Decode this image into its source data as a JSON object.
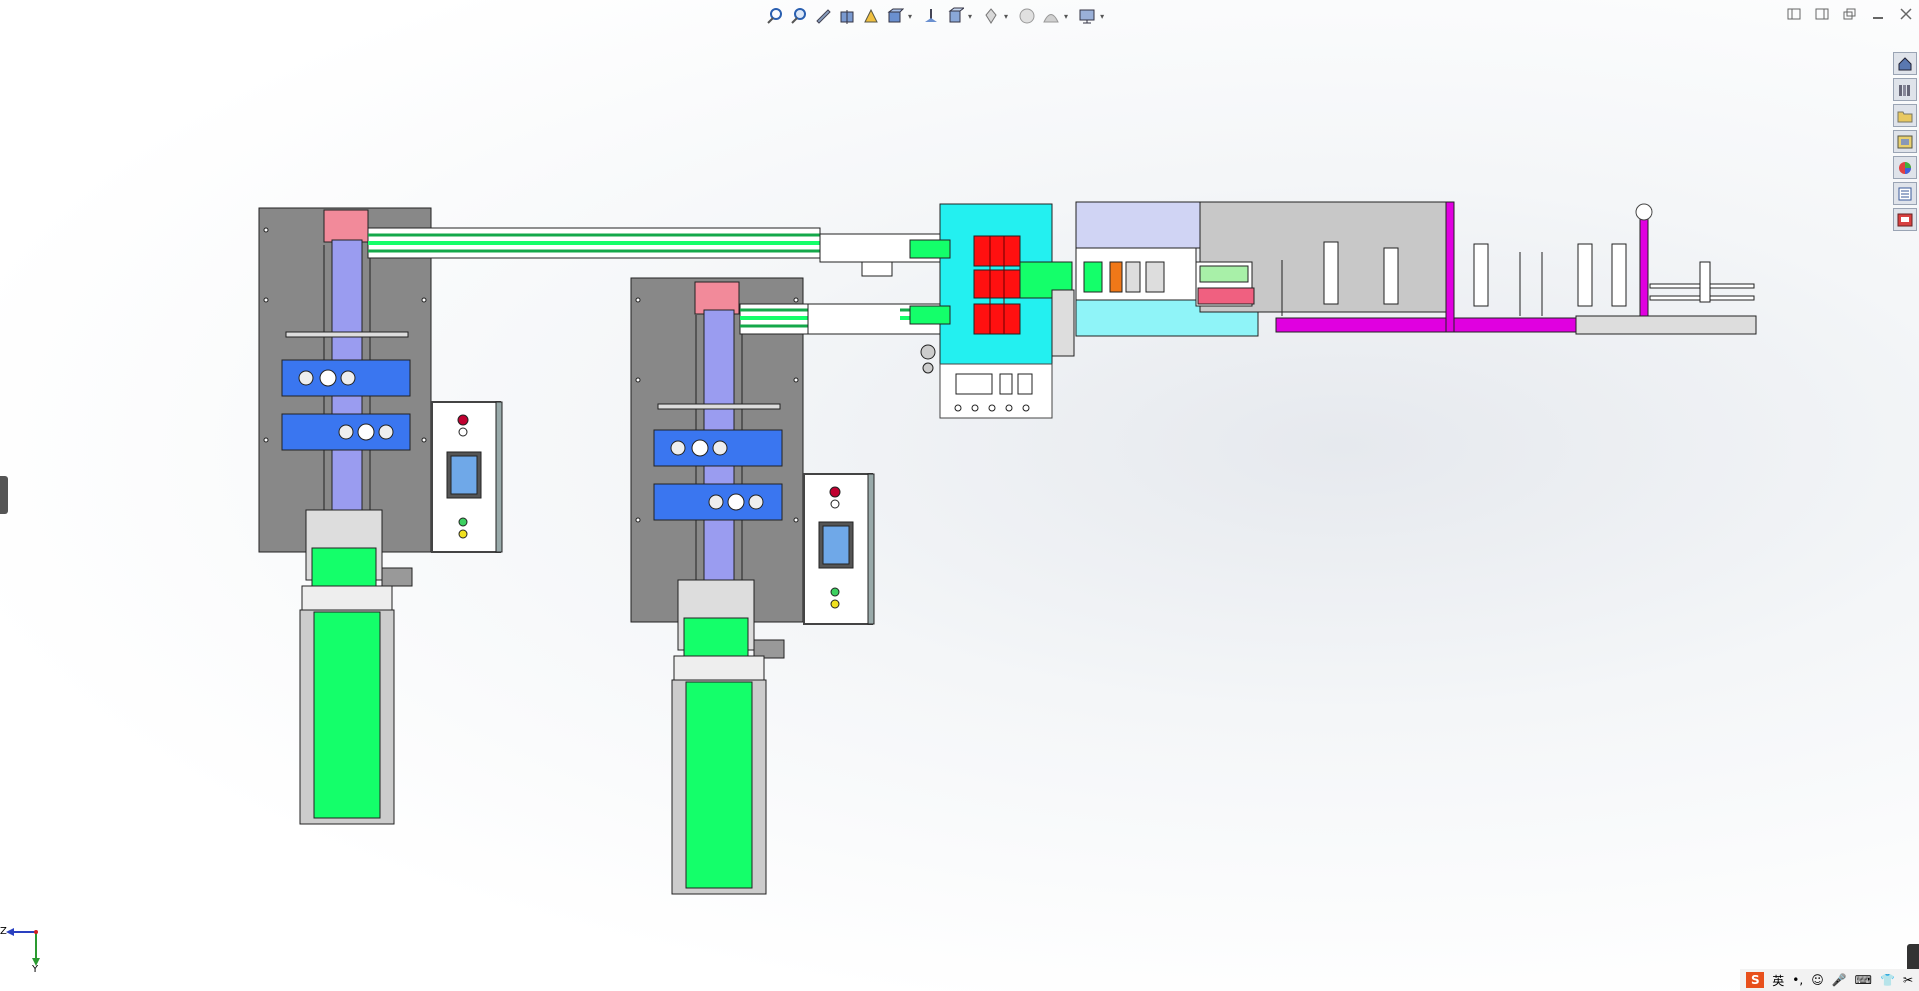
{
  "heads_up_toolbar": {
    "buttons": [
      "zoom-to-fit-icon",
      "zoom-to-area-icon",
      "previous-view-icon",
      "section-view-icon",
      "dynamic-annotation-icon",
      "view-orientation-icon",
      "display-style-icon",
      "hide-show-items-icon",
      "edit-appearance-icon",
      "apply-scene-icon",
      "view-settings-icon"
    ]
  },
  "window_controls": [
    "tile-left-icon",
    "tile-right-icon",
    "restore-icon",
    "minimize-icon",
    "close-icon"
  ],
  "task_pane": [
    "home-icon",
    "design-library-icon",
    "file-explorer-icon",
    "view-palette-icon",
    "appearances-icon",
    "custom-properties-icon",
    "solidworks-forum-icon"
  ],
  "triad": {
    "z_label": "Z",
    "y_label": "Y"
  },
  "ime_bar": {
    "lang": "英",
    "logo": "S"
  },
  "colors": {
    "frame_gray": "#888888",
    "conveyor_green": "#14ff6a",
    "guide_blue": "#3a76f0",
    "lavender": "#9a9cf0",
    "pink": "#f28a9a",
    "cyan": "#23f0f0",
    "red": "#ff1010",
    "magenta": "#e000e0",
    "panel_white": "#ffffff"
  }
}
